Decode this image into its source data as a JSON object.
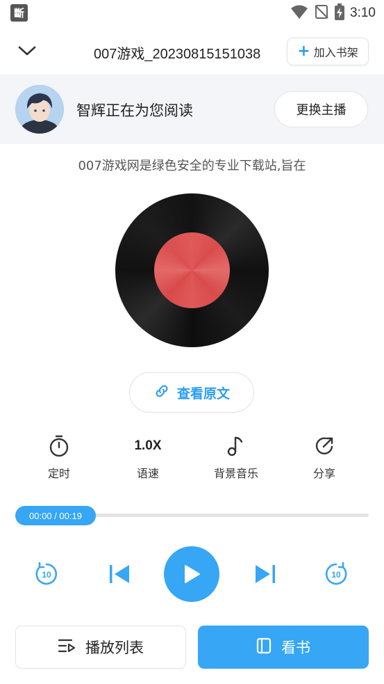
{
  "status_bar": {
    "app_badge": "斷",
    "time": "3:10",
    "icons": [
      "wifi-icon",
      "no-signal-icon",
      "battery-charging-icon"
    ]
  },
  "header": {
    "title": "007游戏_20230815151038",
    "add_shelf_label": "加入书架",
    "icons": [
      "chevron-down-icon",
      "plus-icon"
    ]
  },
  "narrator": {
    "text": "智辉正在为您阅读",
    "change_label": "更换主播"
  },
  "excerpt": "007游戏网是绿色安全的专业下载站,旨在",
  "view_original_label": "查看原文",
  "tools": {
    "timer_label": "定时",
    "speed_value": "1.0X",
    "speed_label": "语速",
    "music_label": "背景音乐",
    "share_label": "分享"
  },
  "progress": {
    "time_text": "00:00 / 00:19",
    "fraction": 0
  },
  "controls": {
    "rewind_seconds": "10",
    "forward_seconds": "10"
  },
  "bottom": {
    "playlist_label": "播放列表",
    "read_label": "看书"
  },
  "colors": {
    "accent": "#36a6f5",
    "record_label": "#e05a5a",
    "narrator_bg": "#f3f5f8"
  }
}
